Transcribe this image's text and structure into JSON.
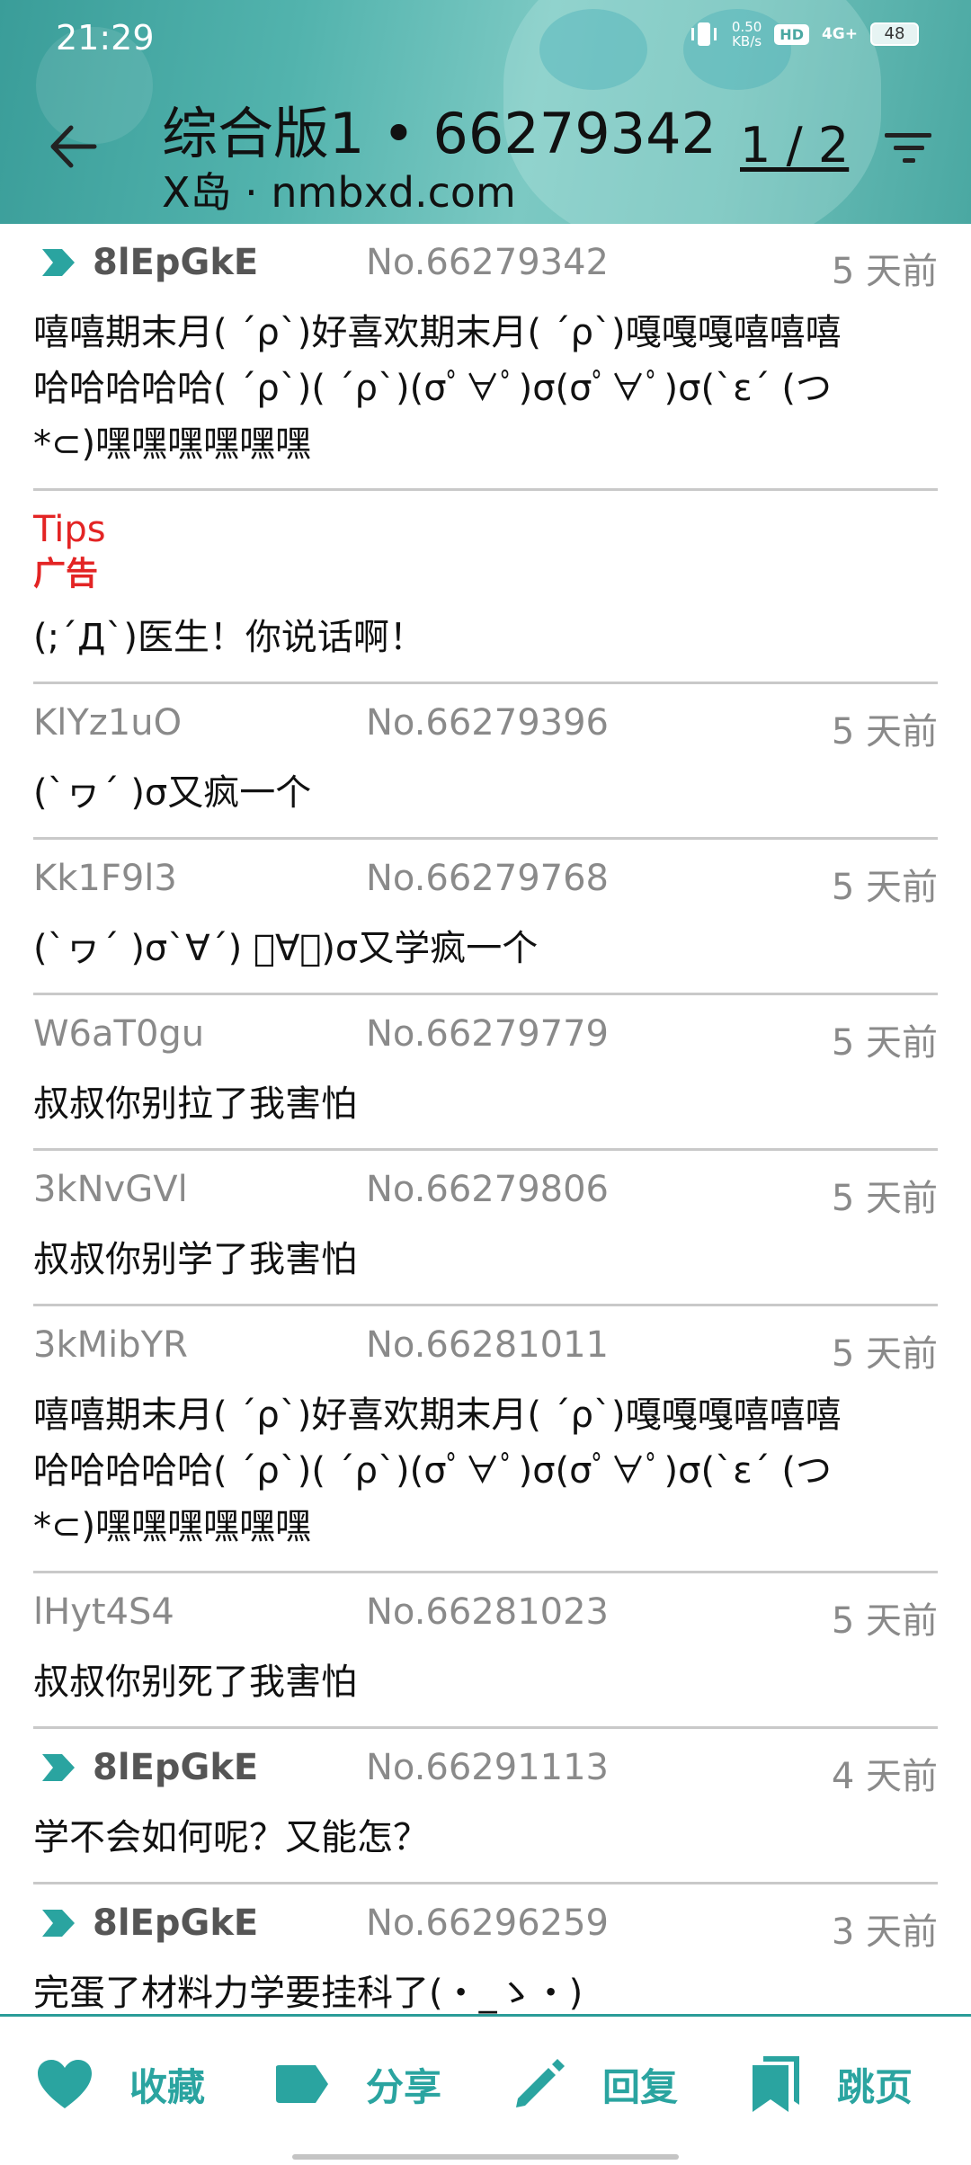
{
  "status_bar": {
    "time": "21:29",
    "net_speed_value": "0.50",
    "net_speed_unit": "KB/s",
    "hd": "HD",
    "network": "4G+",
    "battery": "48"
  },
  "header": {
    "title": "综合版1 • 66279342",
    "subtitle": "X岛 · nmbxd.com",
    "page_indicator": "1 / 2",
    "accent_color": "#2aa4a0"
  },
  "posts": [
    {
      "uid": "8lEpGkE",
      "is_po": true,
      "no": "No.66279342",
      "time": "5 天前",
      "content": "嘻嘻期末月( ´ρ`)好喜欢期末月( ´ρ`)嘎嘎嘎嘻嘻嘻\n哈哈哈哈哈( ´ρ`)( ´ρ`)(σﾟ∀ﾟ)σ(σﾟ∀ﾟ)σ(`ε´ (つ\n*⊂)嘿嘿嘿嘿嘿嘿"
    }
  ],
  "tips": {
    "title": "Tips",
    "tag": "广告",
    "content": "(;´Д`)医生！你说话啊！"
  },
  "replies": [
    {
      "uid": "KlYz1uO",
      "is_po": false,
      "no": "No.66279396",
      "time": "5 天前",
      "content": "(`ヮ´ )σ又疯一个"
    },
    {
      "uid": "Kk1F9l3",
      "is_po": false,
      "no": "No.66279768",
      "time": "5 天前",
      "content": "(`ヮ´ )σ`∀´) ﾟ∀ﾟ)σ又学疯一个"
    },
    {
      "uid": "W6aT0gu",
      "is_po": false,
      "no": "No.66279779",
      "time": "5 天前",
      "content": "叔叔你别拉了我害怕"
    },
    {
      "uid": "3kNvGVl",
      "is_po": false,
      "no": "No.66279806",
      "time": "5 天前",
      "content": "叔叔你别学了我害怕"
    },
    {
      "uid": "3kMibYR",
      "is_po": false,
      "no": "No.66281011",
      "time": "5 天前",
      "content": "嘻嘻期末月( ´ρ`)好喜欢期末月( ´ρ`)嘎嘎嘎嘻嘻嘻\n哈哈哈哈哈( ´ρ`)( ´ρ`)(σﾟ∀ﾟ)σ(σﾟ∀ﾟ)σ(`ε´ (つ\n*⊂)嘿嘿嘿嘿嘿嘿"
    },
    {
      "uid": "lHyt4S4",
      "is_po": false,
      "no": "No.66281023",
      "time": "5 天前",
      "content": "叔叔你别死了我害怕"
    },
    {
      "uid": "8lEpGkE",
      "is_po": true,
      "no": "No.66291113",
      "time": "4 天前",
      "content": "学不会如何呢？又能怎？"
    },
    {
      "uid": "8lEpGkE",
      "is_po": true,
      "no": "No.66296259",
      "time": "3 天前",
      "content": "完蛋了材料力学要挂科了(・_ゝ・)"
    }
  ],
  "bottom_bar": {
    "favorite": "收藏",
    "share": "分享",
    "reply": "回复",
    "jump": "跳页"
  }
}
